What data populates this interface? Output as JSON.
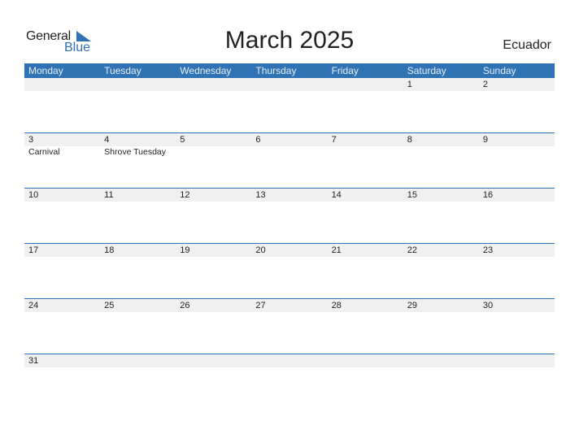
{
  "logo": {
    "general": "General",
    "blue": "Blue"
  },
  "title": "March 2025",
  "country": "Ecuador",
  "colors": {
    "accent": "#2f73b5",
    "row_bg": "#f0f0f0"
  },
  "weekdays": [
    "Monday",
    "Tuesday",
    "Wednesday",
    "Thursday",
    "Friday",
    "Saturday",
    "Sunday"
  ],
  "weeks": [
    {
      "days": [
        "",
        "",
        "",
        "",
        "",
        "1",
        "2"
      ],
      "events": [
        "",
        "",
        "",
        "",
        "",
        "",
        ""
      ]
    },
    {
      "days": [
        "3",
        "4",
        "5",
        "6",
        "7",
        "8",
        "9"
      ],
      "events": [
        "Carnival",
        "Shrove Tuesday",
        "",
        "",
        "",
        "",
        ""
      ]
    },
    {
      "days": [
        "10",
        "11",
        "12",
        "13",
        "14",
        "15",
        "16"
      ],
      "events": [
        "",
        "",
        "",
        "",
        "",
        "",
        ""
      ]
    },
    {
      "days": [
        "17",
        "18",
        "19",
        "20",
        "21",
        "22",
        "23"
      ],
      "events": [
        "",
        "",
        "",
        "",
        "",
        "",
        ""
      ]
    },
    {
      "days": [
        "24",
        "25",
        "26",
        "27",
        "28",
        "29",
        "30"
      ],
      "events": [
        "",
        "",
        "",
        "",
        "",
        "",
        ""
      ]
    },
    {
      "days": [
        "31",
        "",
        "",
        "",
        "",
        "",
        ""
      ],
      "events": [
        "",
        "",
        "",
        "",
        "",
        "",
        ""
      ]
    }
  ]
}
